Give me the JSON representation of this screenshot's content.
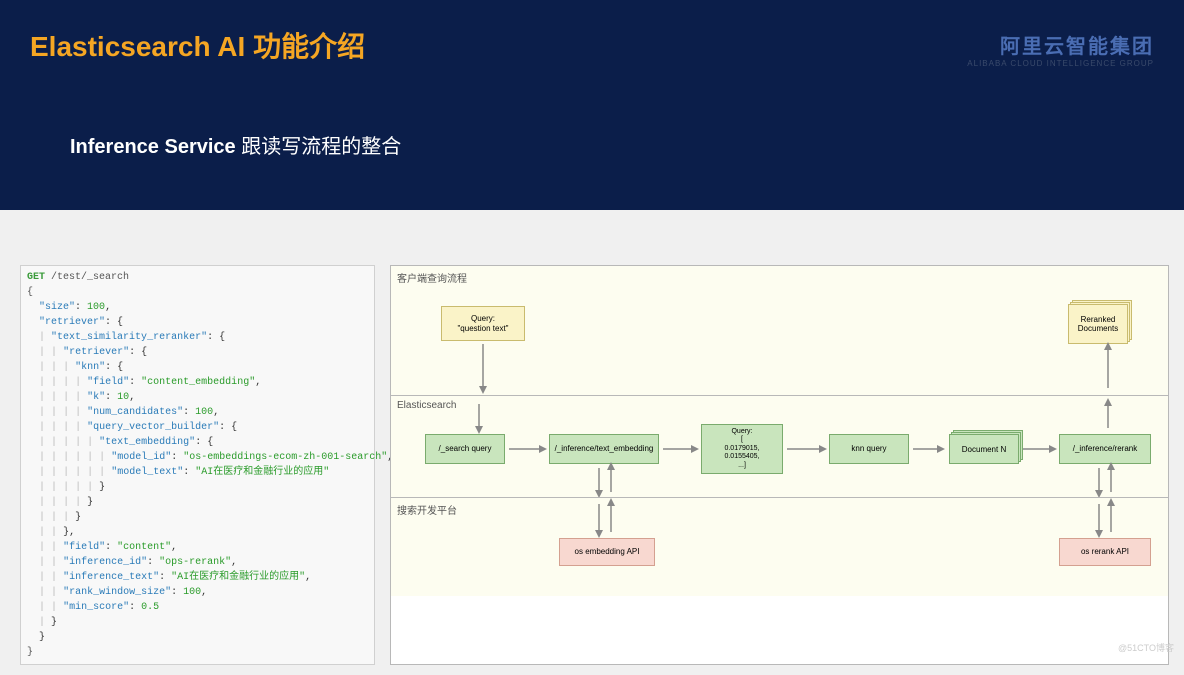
{
  "header": {
    "title": "Elasticsearch AI  功能介绍",
    "logo_cn": "阿里云智能集团",
    "logo_en": "ALIBABA CLOUD INTELLIGENCE GROUP",
    "subtitle_strong": "Inference Service",
    "subtitle_rest": " 跟读写流程的整合"
  },
  "code": {
    "method": "GET",
    "path": "/test/_search",
    "size_key": "\"size\"",
    "size_val": "100",
    "retriever_key": "\"retriever\"",
    "tsr_key": "\"text_similarity_reranker\"",
    "retriever2_key": "\"retriever\"",
    "knn_key": "\"knn\"",
    "field_key": "\"field\"",
    "field_val": "\"content_embedding\"",
    "k_key": "\"k\"",
    "k_val": "10",
    "nc_key": "\"num_candidates\"",
    "nc_val": "100",
    "qvb_key": "\"query_vector_builder\"",
    "te_key": "\"text_embedding\"",
    "mid_key": "\"model_id\"",
    "mid_val": "\"os-embeddings-ecom-zh-001-search\"",
    "mtxt_key": "\"model_text\"",
    "mtxt_val": "\"AI在医疗和金融行业的应用\"",
    "field2_key": "\"field\"",
    "field2_val": "\"content\"",
    "iid_key": "\"inference_id\"",
    "iid_val": "\"ops-rerank\"",
    "itxt_key": "\"inference_text\"",
    "itxt_val": "\"AI在医疗和金融行业的应用\"",
    "rws_key": "\"rank_window_size\"",
    "rws_val": "100",
    "ms_key": "\"min_score\"",
    "ms_val": "0.5"
  },
  "diagram": {
    "lane1_label": "客户端查询流程",
    "lane2_label": "Elasticsearch",
    "lane3_label": "搜索开发平台",
    "query_box_l1": "Query:",
    "query_box_l2": "\"question text\"",
    "reranked_label": "Reranked Documents",
    "search_query_label": "/_search query",
    "text_embed_label": "/_inference/text_embedding",
    "vec_l1": "Query:",
    "vec_l2": "[",
    "vec_l3": "0.0179015,",
    "vec_l4": "0.0155405,",
    "vec_l5": "...]",
    "knn_label": "knn query",
    "docn_label": "Document N",
    "rerank_label": "/_inference/rerank",
    "os_embed_label": "os embedding API",
    "os_rerank_label": "os rerank API"
  },
  "watermark": "@51CTO博客"
}
